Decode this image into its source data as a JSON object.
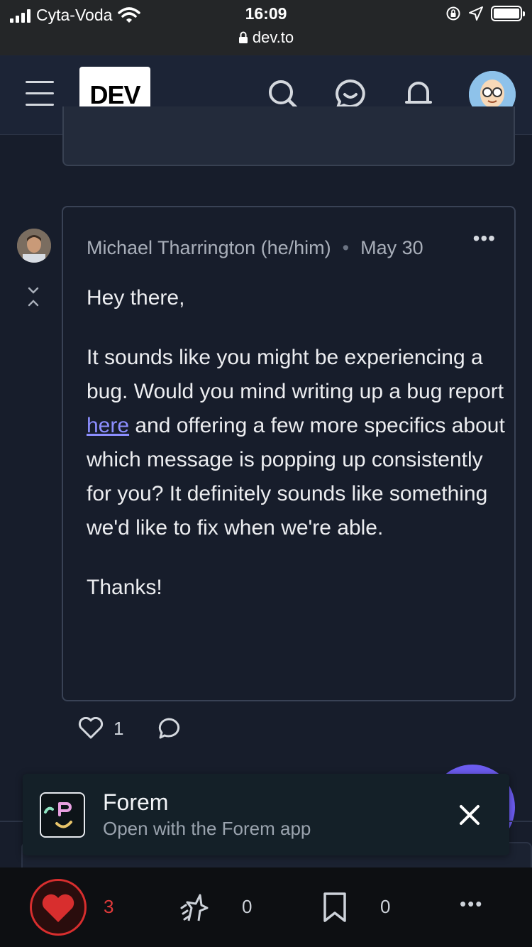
{
  "status_bar": {
    "carrier": "Cyta-Voda",
    "time": "16:09",
    "url": "dev.to"
  },
  "header": {
    "logo_text": "DEV",
    "icons": [
      "menu-icon",
      "search-icon",
      "chat-icon",
      "bell-icon",
      "avatar"
    ]
  },
  "comment": {
    "author": "Michael Tharrington (he/him)",
    "date": "May 30",
    "greeting": "Hey there,",
    "para_before_link": "It sounds like you might be experiencing a bug. Would you mind writing up a bug report ",
    "link_text": "here",
    "para_after_link": " and offering a few more specifics about which message is popping up consistently for you? It definitely sounds like something we'd like to fix when we're able.",
    "closing": "Thanks!",
    "likes": "1"
  },
  "banner": {
    "title": "Forem",
    "subtitle": "Open with the Forem app"
  },
  "bottom_bar": {
    "hearts": "3",
    "unicorns": "0",
    "saves": "0"
  },
  "colors": {
    "background": "#171d2b",
    "link": "#8c8eff",
    "heart": "#d82e2e",
    "fab": "#6c5cf0"
  }
}
